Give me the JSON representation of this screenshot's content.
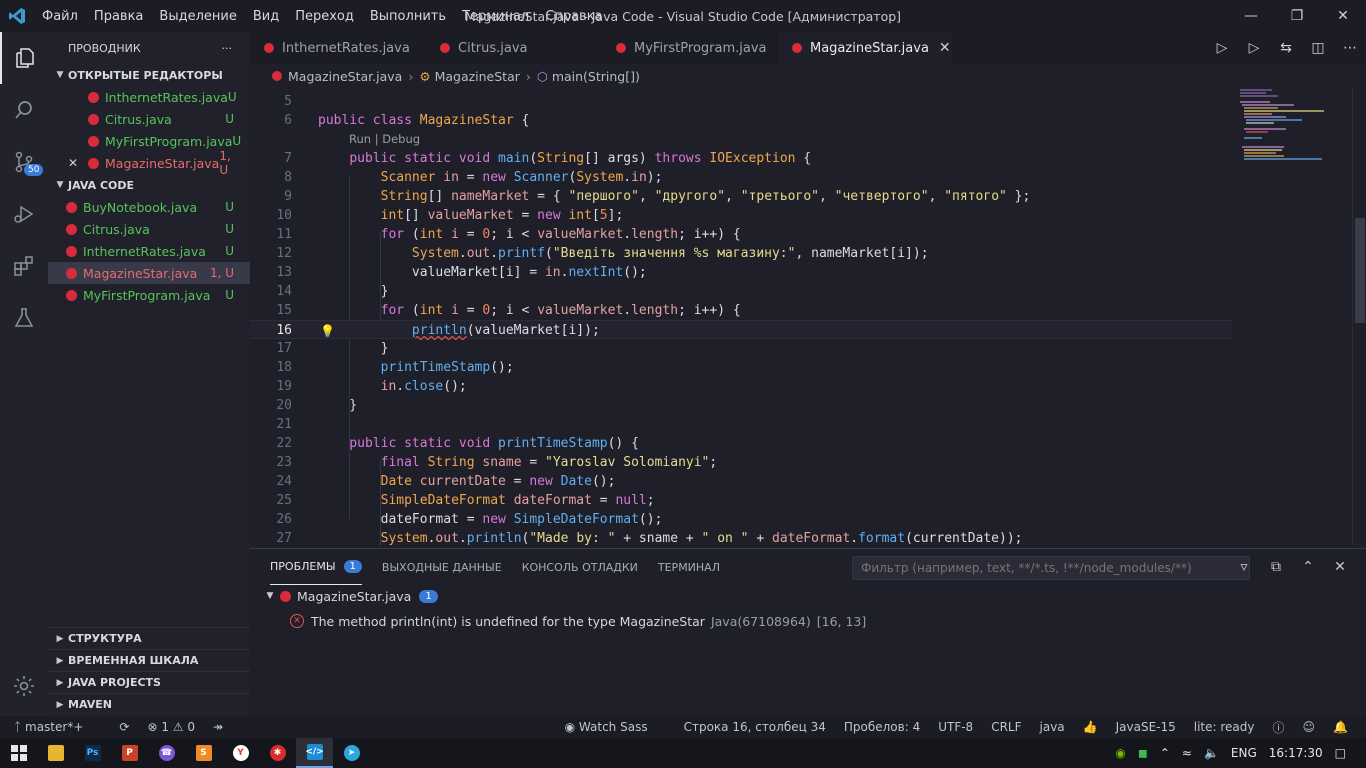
{
  "menu": [
    "Файл",
    "Правка",
    "Выделение",
    "Вид",
    "Переход",
    "Выполнить",
    "Терминал",
    "Справка"
  ],
  "window_title": "MagazineStar.java - Java Code - Visual Studio Code [Администратор]",
  "activity": {
    "scm_badge": "50"
  },
  "sidebar": {
    "title": "ПРОВОДНИК",
    "more": "···",
    "open_editors_title": "ОТКРЫТЫЕ РЕДАКТОРЫ",
    "open_editors": [
      {
        "name": "InthernetRates.java",
        "status": "U"
      },
      {
        "name": "Citrus.java",
        "status": "U"
      },
      {
        "name": "MyFirstProgram.java",
        "status": "U"
      },
      {
        "name": "MagazineStar.java",
        "status": "1, U"
      }
    ],
    "project_title": "JAVA CODE",
    "project_files": [
      {
        "name": "BuyNotebook.java",
        "status": "U"
      },
      {
        "name": "Citrus.java",
        "status": "U"
      },
      {
        "name": "InthernetRates.java",
        "status": "U"
      },
      {
        "name": "MagazineStar.java",
        "status": "1, U"
      },
      {
        "name": "MyFirstProgram.java",
        "status": "U"
      }
    ],
    "bottom_sections": [
      "СТРУКТУРА",
      "ВРЕМЕННАЯ ШКАЛА",
      "JAVA PROJECTS",
      "MAVEN"
    ]
  },
  "tabs": [
    "InthernetRates.java",
    "Citrus.java",
    "MyFirstProgram.java",
    "MagazineStar.java"
  ],
  "breadcrumb": {
    "file": "MagazineStar.java",
    "class": "MagazineStar",
    "method": "main(String[])"
  },
  "code_lens": "Run | Debug",
  "line_numbers": [
    "5",
    "6",
    "7",
    "8",
    "9",
    "10",
    "11",
    "12",
    "13",
    "14",
    "15",
    "16",
    "17",
    "18",
    "19",
    "20",
    "21",
    "22",
    "23",
    "24",
    "25",
    "26",
    "27"
  ],
  "panel": {
    "tabs": [
      "ПРОБЛЕМЫ",
      "ВЫХОДНЫЕ ДАННЫЕ",
      "КОНСОЛЬ ОТЛАДКИ",
      "ТЕРМИНАЛ"
    ],
    "problems_count": "1",
    "filter_placeholder": "Фильтр (например, text, **/*.ts, !**/node_modules/**)",
    "file": "MagazineStar.java",
    "file_count": "1",
    "message": "The method println(int) is undefined for the type MagazineStar",
    "source": "Java(67108964)",
    "location": "[16, 13]"
  },
  "status": {
    "branch": "master*+",
    "problems": "⊗ 1 ⚠ 0",
    "watch_sass": "Watch Sass",
    "position": "Строка 16, столбец 34",
    "spaces": "Пробелов: 4",
    "encoding": "UTF-8",
    "eol": "CRLF",
    "language": "java",
    "jdk": "JavaSE-15",
    "lite": "lite: ready"
  },
  "taskbar": {
    "lang": "ENG",
    "time": "16:17:30"
  },
  "colors": {
    "accent": "#3a7bd5",
    "error": "#d92c3a",
    "untracked": "#58c35a"
  }
}
